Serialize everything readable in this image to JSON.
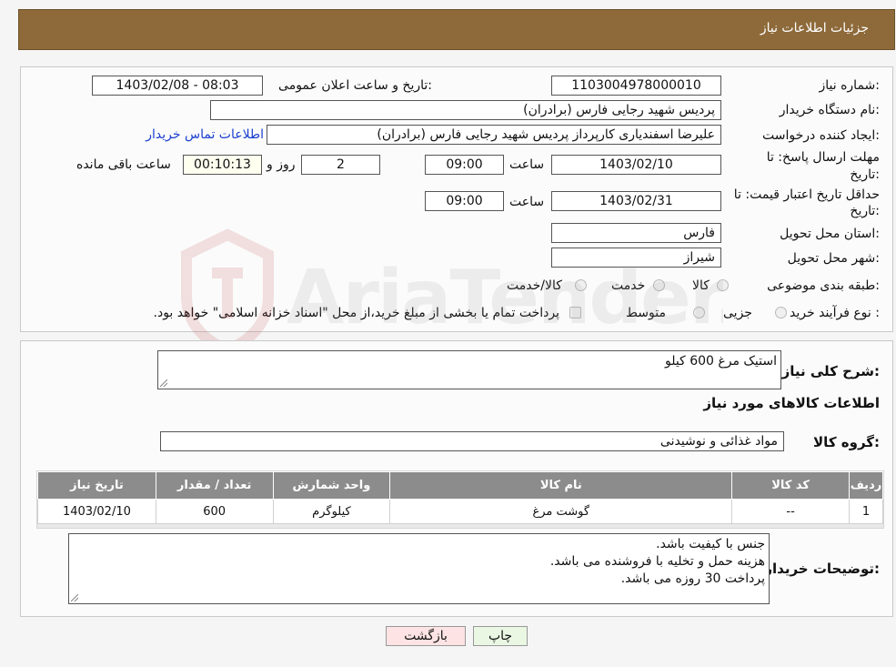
{
  "header": {
    "title": "جزئیات اطلاعات نیاز"
  },
  "form": {
    "need_number_label": "شماره نیاز:",
    "need_number": "1103004978000010",
    "announce_label": "تاریخ و ساعت اعلان عمومی:",
    "announce_value": "1403/02/08 - 08:03",
    "buyer_org_label": "نام دستگاه خریدار:",
    "buyer_org": "پردیس شهید رجایی فارس (برادران)",
    "creator_label": "ایجاد کننده درخواست:",
    "creator": "علیرضا اسفندیاری کارپرداز پردیس شهید رجایی فارس (برادران)",
    "contact_link": "اطلاعات تماس خریدار",
    "reply_deadline_label_1": "مهلت ارسال پاسخ: تا",
    "reply_deadline_label_2": "تاریخ:",
    "reply_date": "1403/02/10",
    "time_label": "ساعت",
    "reply_time": "09:00",
    "days_value": "2",
    "days_label": "روز و",
    "remaining_time": "00:10:13",
    "remaining_label": "ساعت باقی مانده",
    "price_validity_label_1": "حداقل تاریخ اعتبار قیمت: تا",
    "price_validity_label_2": "تاریخ:",
    "validity_date": "1403/02/31",
    "validity_time": "09:00",
    "province_label": "استان محل تحویل:",
    "province": "فارس",
    "city_label": "شهر محل تحویل:",
    "city": "شیراز",
    "category_label": "طبقه بندی موضوعی:",
    "category_options": [
      "کالا",
      "خدمت",
      "کالا/خدمت"
    ],
    "process_label": "نوع فرآیند خرید :",
    "process_options": [
      "جزیی",
      "متوسط"
    ],
    "payment_note": "پرداخت تمام یا بخشی از مبلغ خرید،از محل \"اسناد خزانه اسلامی\" خواهد بود."
  },
  "details": {
    "summary_label": "شرح کلی نیاز:",
    "summary_value": "استیک مرغ 600 کیلو",
    "goods_info_title": "اطلاعات کالاهای مورد نیاز",
    "group_label": "گروه کالا:",
    "group_value": "مواد غذائی و نوشیدنی",
    "table": {
      "headers": [
        "ردیف",
        "کد کالا",
        "نام کالا",
        "واحد شمارش",
        "تعداد / مقدار",
        "تاریخ نیاز"
      ],
      "rows": [
        [
          "1",
          "--",
          "گوشت مرغ",
          "کیلوگرم",
          "600",
          "1403/02/10"
        ]
      ]
    },
    "buyer_notes_label": "توضیحات خریدار:",
    "buyer_notes": [
      "جنس با کیفیت باشد.",
      "هزینه حمل و تخلیه با فروشنده می باشد.",
      "پرداخت 30 روزه می باشد."
    ]
  },
  "buttons": {
    "print": "چاپ",
    "back": "بازگشت"
  },
  "watermark": {
    "text": "AriaTender.neT"
  },
  "colors": {
    "header": "#8e6a3a",
    "table_header": "#8c8c8c",
    "link": "#1a3fcf",
    "back_button": "#fde3e3",
    "print_button": "#eaf7e3"
  }
}
